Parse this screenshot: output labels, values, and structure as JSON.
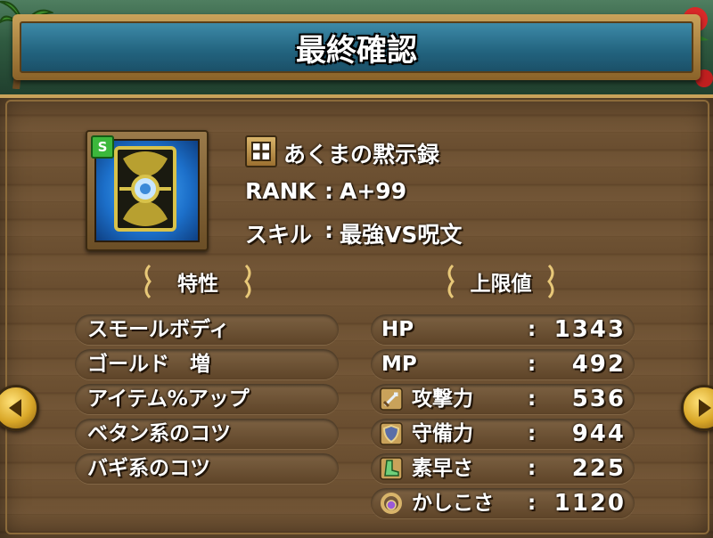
{
  "title": "最終確認",
  "item": {
    "grade_badge": "S",
    "icon": "demon-book-icon",
    "name": "あくまの黙示録",
    "rank_label": "RANK",
    "rank_value": "A+99",
    "skill_label": "スキル",
    "skill_value": "最強VS呪文"
  },
  "traits": {
    "header": "特性",
    "items": [
      "スモールボディ",
      "ゴールド　増",
      "アイテム%アップ",
      "ベタン系のコツ",
      "バギ系のコツ"
    ]
  },
  "stats": {
    "header": "上限値",
    "items": [
      {
        "label": "HP",
        "value": "1343",
        "icon": ""
      },
      {
        "label": "MP",
        "value": "492",
        "icon": ""
      },
      {
        "label": "攻撃力",
        "value": "536",
        "icon": "sword-icon"
      },
      {
        "label": "守備力",
        "value": "944",
        "icon": "shield-icon"
      },
      {
        "label": "素早さ",
        "value": "225",
        "icon": "boot-icon"
      },
      {
        "label": "かしこさ",
        "value": "1120",
        "icon": "wisdom-ring-icon"
      }
    ]
  },
  "colors": {
    "title_bar": "#22637e",
    "wood": "#6e5233",
    "gold": "#c9a25a",
    "grade_badge": "#3cb83c"
  }
}
